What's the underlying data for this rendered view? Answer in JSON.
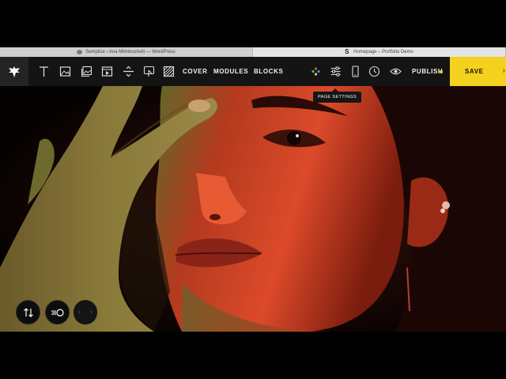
{
  "browser": {
    "tabs": [
      {
        "title": "Semplice ‹ Ana Miminoshvili — WordPress"
      },
      {
        "title": "Homepage – Portfolio Demo"
      }
    ],
    "tab2_favicon": "S"
  },
  "toolbar": {
    "items": [
      {
        "icon": "text-icon"
      },
      {
        "icon": "image-icon"
      },
      {
        "icon": "gallery-icon"
      },
      {
        "icon": "video-icon"
      },
      {
        "icon": "spacer-icon"
      },
      {
        "icon": "button-icon"
      },
      {
        "icon": "pattern-icon"
      }
    ],
    "cover_label": "COVER",
    "modules_label": "MODULES",
    "blocks_label": "BLOCKS",
    "publish_label": "PUBLISH",
    "save_label": "SAVE",
    "save_chevron": "›",
    "tooltip": "PAGE SETTINGS"
  },
  "colors": {
    "accent": "#f4d11c",
    "toolbar_bg": "#141414"
  },
  "canvas": {
    "pager_prev": "‹",
    "pager_next": "›"
  }
}
